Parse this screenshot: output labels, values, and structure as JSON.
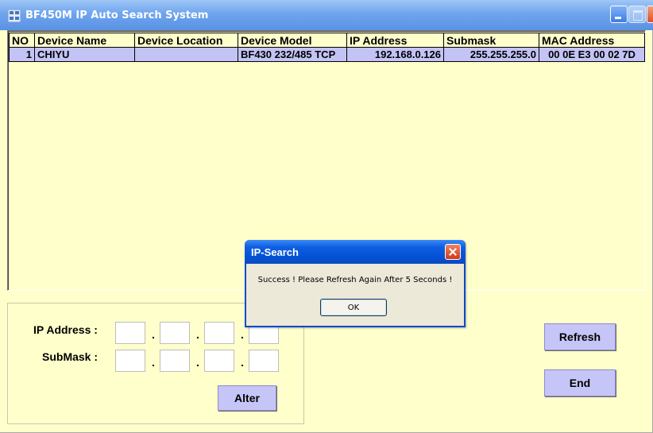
{
  "window": {
    "title": "BF450M IP Auto Search System",
    "app_icon": "app-network-icon"
  },
  "grid": {
    "columns": [
      "NO",
      "Device Name",
      "Device Location",
      "Device Model",
      "IP Address",
      "Submask",
      "MAC Address"
    ],
    "rows": [
      {
        "no": "1",
        "name": "CHIYU",
        "location": "",
        "model": "BF430 232/485 TCP",
        "ip": "192.168.0.126",
        "submask": "255.255.255.0",
        "mac": "00 0E E3 00 02 7D"
      }
    ]
  },
  "form": {
    "ip_label": "IP Address :",
    "submask_label": "SubMask :",
    "separator": ".",
    "ip_octets": [
      "",
      "",
      "",
      ""
    ],
    "submask_octets": [
      "",
      "",
      "",
      ""
    ],
    "alter_label": "Alter"
  },
  "buttons": {
    "refresh": "Refresh",
    "end": "End"
  },
  "dialog": {
    "title": "IP-Search",
    "message": "Success ! Please Refresh Again After 5 Seconds !",
    "ok_label": "OK"
  },
  "colors": {
    "window_bg": "#ffffcc",
    "row_highlight": "#c3c3f6",
    "button_bg": "#c5c5f7",
    "titlebar": "#5a92e4",
    "dialog_titlebar": "#0452d4"
  }
}
